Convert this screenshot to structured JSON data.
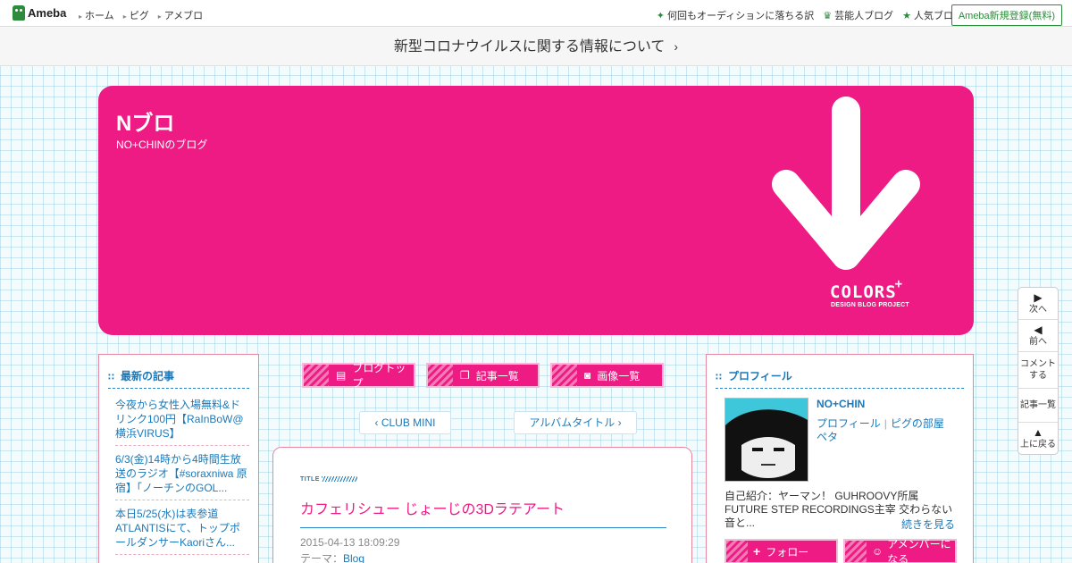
{
  "topbar": {
    "logo": "Ameba",
    "nav": [
      "ホーム",
      "ピグ",
      "アメブロ"
    ],
    "links": [
      {
        "icon": "sparkle-icon",
        "label": "何回もオーディションに落ちる訳"
      },
      {
        "icon": "crown-icon",
        "label": "芸能人ブログ"
      },
      {
        "icon": "star-icon",
        "label": "人気ブログ"
      }
    ],
    "register": "Ameba新規登録(無料)"
  },
  "notice": {
    "text": "新型コロナウイルスに関する情報について",
    "chevron": "›"
  },
  "header": {
    "title": "Nブロ",
    "description": "NO+CHINのブログ",
    "colors_logo": "COLORS",
    "colors_plus": "+",
    "colors_sub": "DESIGN BLOG PROJECT",
    "accent": "#ee1b84"
  },
  "sidebar_left": {
    "heading": "最新の記事",
    "entries": [
      "今夜から女性入場無料&ドリンク100円【RaInBoW@横浜VIRUS】",
      "6/3(金)14時から4時間生放送のラジオ【#soraxniwa 原宿】「ノーチンのGOL...",
      "本日5/25(水)は表参道ATLANTISにて、トップポールダンサーKaoriさん..."
    ]
  },
  "nav_buttons": [
    {
      "icon": "document-icon",
      "label": "ブログトップ"
    },
    {
      "icon": "copy-icon",
      "label": "記事一覧"
    },
    {
      "icon": "camera-icon",
      "label": "画像一覧"
    }
  ],
  "sub_nav": {
    "prev": "‹ CLUB MINI",
    "next": "アルバムタイトル ›"
  },
  "article": {
    "tag": "TITLE",
    "title": "カフェリシュー じょーじの3Dラテアート",
    "date": "2015-04-13 18:09:29",
    "theme_label": "テーマ：",
    "theme": "Blog"
  },
  "profile": {
    "heading": "プロフィール",
    "name": "NO+CHIN",
    "link1": "プロフィール",
    "link_sep": "|",
    "link2": "ピグの部屋",
    "peta": "ペタ",
    "intro": "自己紹介：ヤーマン！ GUHROOVY所属 FUTURE STEP RECORDINGS主宰 交わらない音と...",
    "more": "続きを見る",
    "follow": "フォロー",
    "member": "アメンバーになる"
  },
  "sidenav": [
    {
      "icon": "triangle-right-icon",
      "glyph": "▶",
      "label": "次へ"
    },
    {
      "icon": "triangle-left-icon",
      "glyph": "◀",
      "label": "前へ"
    },
    {
      "icon": "",
      "glyph": "",
      "label": "コメントする"
    },
    {
      "icon": "",
      "glyph": "",
      "label": "記事一覧"
    },
    {
      "icon": "triangle-up-icon",
      "glyph": "▲",
      "label": "上に戻る"
    }
  ]
}
